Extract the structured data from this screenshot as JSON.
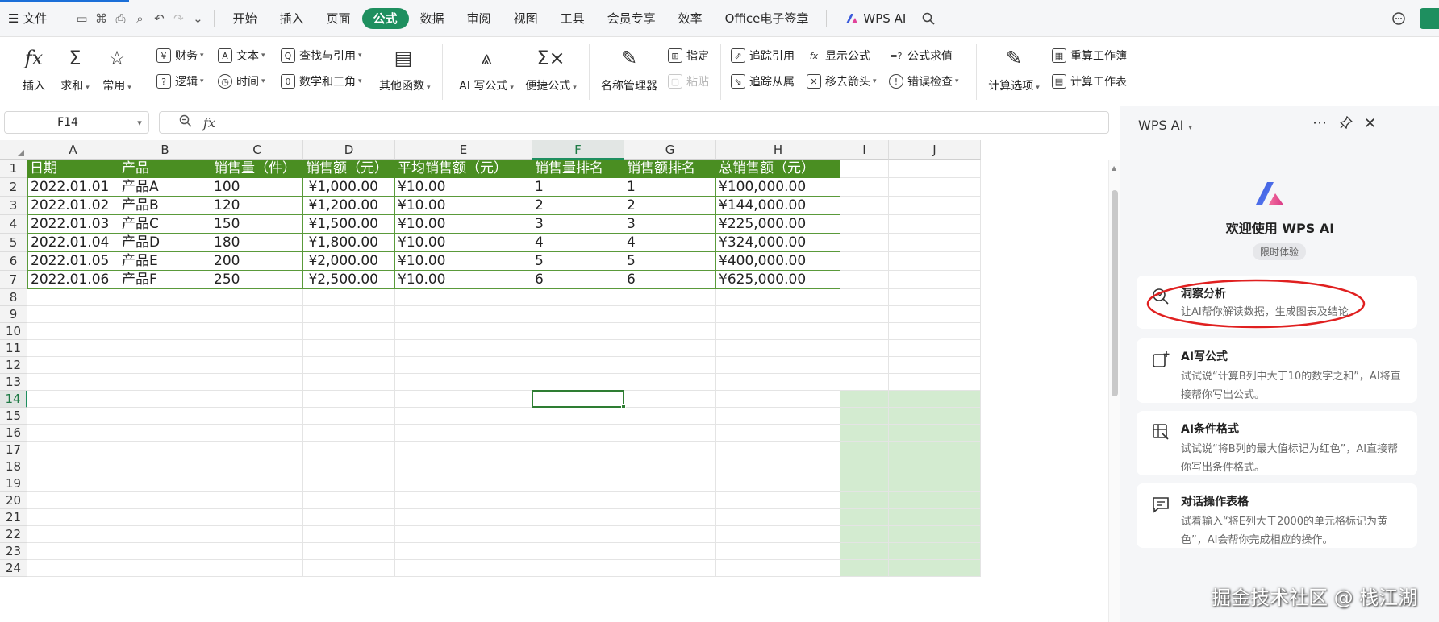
{
  "menubar": {
    "menu_icon": "☰",
    "file": "文件",
    "tabs": [
      "开始",
      "插入",
      "页面",
      "公式",
      "数据",
      "审阅",
      "视图",
      "工具",
      "会员专享",
      "效率",
      "Office电子签章"
    ],
    "active_tab": "公式",
    "wps_ai": "WPS AI"
  },
  "ribbon": {
    "insert_fn": "插入",
    "sum": "求和",
    "common": "常用",
    "finance": "财务",
    "text": "文本",
    "lookup": "查找与引用",
    "logic": "逻辑",
    "time": "时间",
    "math": "数学和三角",
    "other_fn": "其他函数",
    "ai_formula": "AI 写公式",
    "quick_formula": "便捷公式",
    "name_manager": "名称管理器",
    "specify": "指定",
    "paste": "粘贴",
    "trace_prec": "追踪引用",
    "show_formula": "显示公式",
    "eval_formula": "公式求值",
    "trace_dep": "追踪从属",
    "remove_arrows": "移去箭头",
    "error_check": "错误检查",
    "calc_options": "计算选项",
    "recalc_book": "重算工作簿",
    "calc_sheet": "计算工作表"
  },
  "formula_bar": {
    "namebox": "F14",
    "fx": "fx",
    "value": ""
  },
  "sheet": {
    "columns": [
      "A",
      "B",
      "C",
      "D",
      "E",
      "F",
      "G",
      "H",
      "I",
      "J"
    ],
    "rows": [
      "1",
      "2",
      "3",
      "4",
      "5",
      "6",
      "7",
      "8",
      "9",
      "10",
      "11",
      "12",
      "13",
      "14",
      "15",
      "16",
      "17",
      "18",
      "19",
      "20",
      "21",
      "22",
      "23",
      "24"
    ],
    "selected_col": "F",
    "selected_row": "14",
    "header": [
      "日期",
      "产品",
      "销售量（件）",
      "销售额（元）",
      "平均销售额（元）",
      "销售量排名",
      "销售额排名",
      "总销售额（元）"
    ],
    "data": [
      [
        "2022.01.01",
        "产品A",
        "100",
        "¥1,000.00",
        "¥10.00",
        "1",
        "1",
        "¥100,000.00"
      ],
      [
        "2022.01.02",
        "产品B",
        "120",
        "¥1,200.00",
        "¥10.00",
        "2",
        "2",
        "¥144,000.00"
      ],
      [
        "2022.01.03",
        "产品C",
        "150",
        "¥1,500.00",
        "¥10.00",
        "3",
        "3",
        "¥225,000.00"
      ],
      [
        "2022.01.04",
        "产品D",
        "180",
        "¥1,800.00",
        "¥10.00",
        "4",
        "4",
        "¥324,000.00"
      ],
      [
        "2022.01.05",
        "产品E",
        "200",
        "¥2,000.00",
        "¥10.00",
        "5",
        "5",
        "¥400,000.00"
      ],
      [
        "2022.01.06",
        "产品F",
        "250",
        "¥2,500.00",
        "¥10.00",
        "6",
        "6",
        "¥625,000.00"
      ]
    ]
  },
  "ai_panel": {
    "title": "WPS AI",
    "welcome": "欢迎使用 WPS AI",
    "badge": "限时体验",
    "cards": [
      {
        "title": "洞察分析",
        "desc": "让AI帮你解读数据，生成图表及结论。"
      },
      {
        "title": "AI写公式",
        "desc": "试试说“计算B列中大于10的数字之和”，AI将直接帮你写出公式。"
      },
      {
        "title": "AI条件格式",
        "desc": "试试说“将B列的最大值标记为红色”，AI直接帮你写出条件格式。"
      },
      {
        "title": "对话操作表格",
        "desc": "试着输入“将E列大于2000的单元格标记为黄色”，AI会帮你完成相应的操作。"
      }
    ]
  },
  "watermark": "掘金技术社区 @ 栈江湖",
  "colors": {
    "accent": "#1e8f5f",
    "table_header": "#4a8e22",
    "highlight_ring": "#e02020"
  }
}
